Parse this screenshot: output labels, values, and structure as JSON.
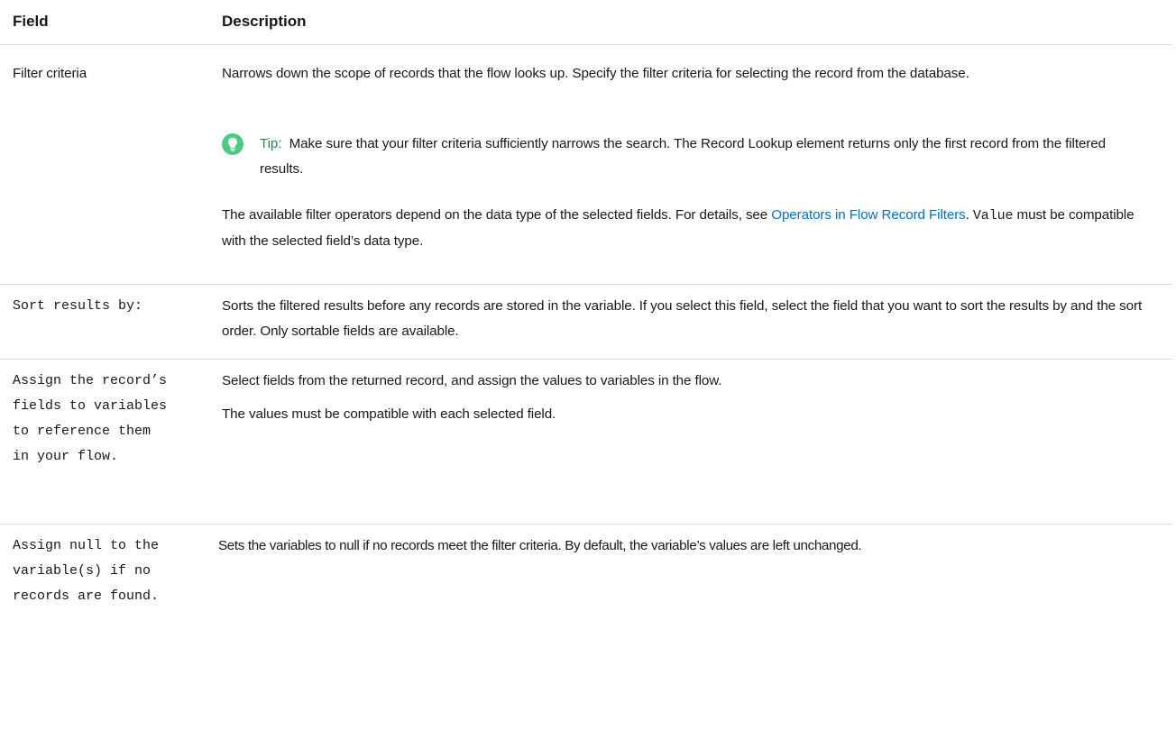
{
  "table": {
    "header": {
      "field": "Field",
      "description": "Description"
    },
    "rows": [
      {
        "field": "Filter criteria",
        "desc_p1": "Narrows down the scope of records that the flow looks up. Specify the filter criteria for selecting the record from the database.",
        "tip_label": "Tip:",
        "tip_text": "Make sure that your filter criteria sufficiently narrows the search. The Record Lookup element returns only the first record from the filtered results.",
        "desc_p3_before": "The available filter operators depend on the data type of the selected fields. For details, see ",
        "desc_p3_link": "Operators in Flow Record Filters",
        "desc_p3_middle": ". ",
        "desc_p3_code": "Value",
        "desc_p3_after": " must be compatible with the selected field’s data type."
      },
      {
        "field": "Sort results by:",
        "desc_p1": "Sorts the filtered results before any records are stored in the variable. If you select this field, select the field that you want to sort the results by and the sort order. Only sortable fields are available."
      },
      {
        "field": "Assign the record’s fields to variables to reference them in your flow.",
        "desc_p1": "Select fields from the returned record, and assign the values to variables in the flow.",
        "desc_p2": "The values must be compatible with each selected field."
      },
      {
        "field": "Assign null to the variable(s) if no records are found.",
        "desc_p1": "Sets the variables to null if no records meet the filter criteria. By default, the variable’s values are left unchanged."
      }
    ]
  },
  "icons": {
    "tip": "lightbulb-icon"
  },
  "colors": {
    "link": "#0070d2",
    "tip_label": "#2e844a",
    "tip_icon_bg": "#4bca81",
    "divider": "#d8dde6"
  }
}
